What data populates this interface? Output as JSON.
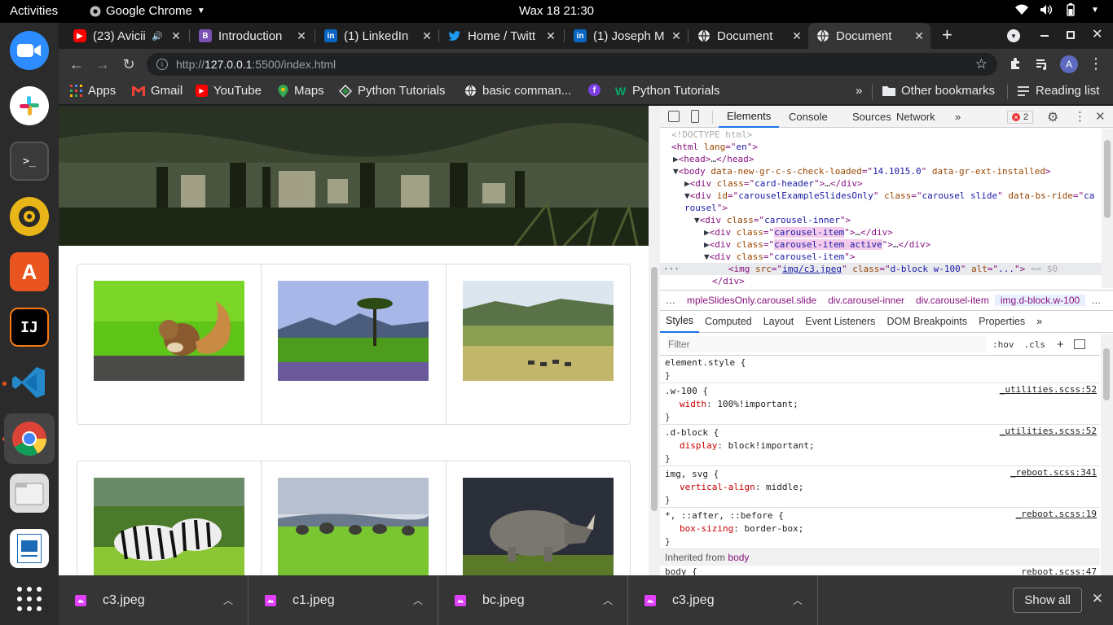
{
  "topbar": {
    "activities": "Activities",
    "app_name": "Google Chrome",
    "clock": "Wax 18  21:30"
  },
  "dock": {
    "apps": [
      "Zoom",
      "Slack",
      "Terminal",
      "Rhythmbox",
      "Ubuntu Software",
      "IntelliJ IDEA",
      "Visual Studio Code",
      "Google Chrome",
      "Files",
      "LibreOffice Impress",
      "Show Applications"
    ]
  },
  "tabs": [
    {
      "title": "(23) Avicii",
      "icon": "youtube-icon",
      "color": "#ff0000"
    },
    {
      "title": "Introduction",
      "icon": "bootstrap-icon",
      "color": "#7952b3"
    },
    {
      "title": "(1) LinkedIn",
      "icon": "linkedin-icon",
      "color": "#0a66c2"
    },
    {
      "title": "Home / Twitt",
      "icon": "twitter-icon",
      "color": "#1d9bf0"
    },
    {
      "title": "(1) Joseph M",
      "icon": "linkedin-icon",
      "color": "#0a66c2"
    },
    {
      "title": "Document",
      "icon": "globe-icon",
      "color": "#e8eaed"
    },
    {
      "title": "Document",
      "icon": "globe-icon",
      "color": "#e8eaed",
      "active": true
    }
  ],
  "address": {
    "scheme": "http://",
    "host": "127.0.0.1",
    "rest": ":5500/index.html"
  },
  "bookmarks": {
    "items": [
      "Apps",
      "Gmail",
      "YouTube",
      "Maps",
      "Python Tutorials",
      "basic comman...",
      "",
      "Python Tutorials"
    ],
    "other": "Other bookmarks",
    "reading": "Reading list",
    "overflow": "»"
  },
  "page": {
    "gallery_rows": [
      [
        "squirrel",
        "acacia-lake",
        "plains-zebras"
      ],
      [
        "zebras",
        "elephants",
        "rhino"
      ]
    ]
  },
  "devtools": {
    "tabs": [
      "Elements",
      "Console",
      "Sources",
      "Network"
    ],
    "more": "»",
    "error_count": "2",
    "dom_lines": [
      {
        "t": "<!DOCTYPE html>"
      },
      {
        "t": "<html lang=\"en\">"
      },
      {
        "t": "▶<head>…</head>"
      },
      {
        "t": "▼<body data-new-gr-c-s-check-loaded=\"14.1015.0\" data-gr-ext-installed>"
      },
      {
        "t": "▶<div class=\"card-header\">…</div>"
      },
      {
        "t": "▼<div id=\"carouselExampleSlidesOnly\" class=\"carousel slide\" data-bs-ride=\"ca"
      },
      {
        "t": "rousel\">"
      },
      {
        "t": "▼<div class=\"carousel-inner\">"
      },
      {
        "t": "▶<div class=\"carousel-item\">…</div>"
      },
      {
        "t": "▶<div class=\"carousel-item active\">…</div>"
      },
      {
        "t": "▼<div class=\"carousel-item\">"
      },
      {
        "t": "<img src=\"img/c3.jpeg\" class=\"d-block w-100\" alt=\"...\"> == $0"
      },
      {
        "t": "</div>"
      }
    ],
    "crumbs": [
      "…",
      "mpleSlidesOnly.carousel.slide",
      "div.carousel-inner",
      "div.carousel-item",
      "img.d-block.w-100",
      "…"
    ],
    "subtabs": [
      "Styles",
      "Computed",
      "Layout",
      "Event Listeners",
      "DOM Breakpoints",
      "Properties",
      "»"
    ],
    "filter_placeholder": "Filter",
    "hov": ":hov",
    "cls": ".cls",
    "plus": "+",
    "rules": [
      {
        "selector": "element.style {",
        "source": "",
        "props": []
      },
      {
        "selector": ".w-100 {",
        "source": "_utilities.scss:52",
        "props": [
          {
            "n": "width",
            "v": "100%!important;"
          }
        ]
      },
      {
        "selector": ".d-block {",
        "source": "_utilities.scss:52",
        "props": [
          {
            "n": "display",
            "v": "block!important;"
          }
        ]
      },
      {
        "selector": "img, svg {",
        "source": "_reboot.scss:341",
        "props": [
          {
            "n": "vertical-align",
            "v": "middle;"
          }
        ]
      },
      {
        "selector": "*, ::after, ::before {",
        "source": "_reboot.scss:19",
        "props": [
          {
            "n": "box-sizing",
            "v": "border-box;"
          }
        ]
      }
    ],
    "inherited_label": "Inherited from",
    "inherited_from": "body",
    "last_selector": "body {",
    "last_source": "_reboot.scss:47"
  },
  "downloads": {
    "files": [
      "c3.jpeg",
      "c1.jpeg",
      "bc.jpeg",
      "c3.jpeg"
    ],
    "show_all": "Show all"
  }
}
